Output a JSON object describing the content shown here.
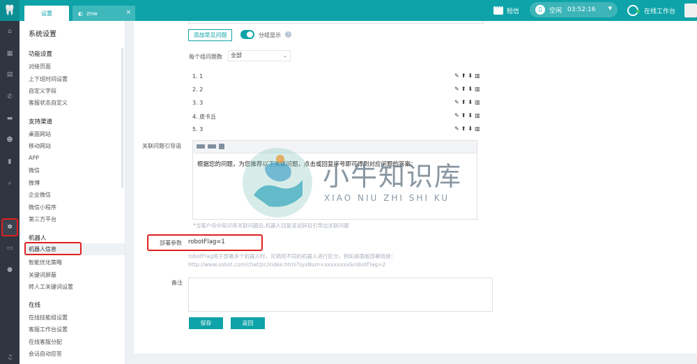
{
  "topbar": {
    "tabs": [
      {
        "label": "设置"
      },
      {
        "label": "znw",
        "close": "×"
      }
    ],
    "sms_label": "短信",
    "status": {
      "state": "空闲",
      "time": "03:52:16"
    },
    "workspace_label": "在线工作台"
  },
  "menu": {
    "title": "系统设置",
    "groups": [
      {
        "heading": "功能设置",
        "items": [
          "对接页面",
          "上下班时间设置",
          "自定义字段",
          "客服状态自定义"
        ]
      },
      {
        "heading": "支持渠道",
        "items": [
          "桌面网站",
          "移动网站",
          "APP",
          "微信",
          "微博",
          "企业微信",
          "微信小程序",
          "第三方平台"
        ]
      },
      {
        "heading": "机器人",
        "items": [
          "机器人信息",
          "智能优化策略",
          "关键词屏蔽",
          "转人工关键词设置"
        ]
      },
      {
        "heading": "在线",
        "items": [
          "在线技能组设置",
          "客服工作台设置",
          "在线客服分配",
          "会话自动应答"
        ]
      }
    ],
    "active_item": "机器人信息"
  },
  "form": {
    "add_faq_button": "添加常见问题",
    "group_display_label": "分组显示",
    "per_group_label": "每个组问题数",
    "per_group_value": "全部",
    "questions": [
      "1. 1",
      "2. 2",
      "3. 3",
      "4. 皮卡丘",
      "5. 3"
    ],
    "related_guide_label": "关联问题引导语",
    "editor_text": "根据您的问题，为您推荐以下关联问题，点击或回复序号即可得到对应问题的答案：",
    "editor_hint": "*当客户命中知识库关联问题后,机器人回复该说辞且引导出关联问题",
    "deploy_label": "部署参数",
    "deploy_value": "robotFlag=1",
    "deploy_hint_1": "robotFlag用于部署多个机器人时，对调用不同的机器人进行区分，例如桌面版部署链接：",
    "deploy_hint_2": "http://www.sobot.com/chat/pc/index.html?sysNum=xxxxxxxx&robotFlag=2",
    "remark_label": "备注",
    "save_button": "保存",
    "back_button": "返回"
  },
  "watermark": {
    "title": "小牛知识库",
    "subtitle": "XIAO NIU ZHI SHI KU"
  }
}
